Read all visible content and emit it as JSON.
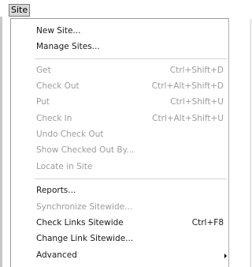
{
  "menubar": {
    "title": "Site"
  },
  "menu": {
    "new_site": "New Site...",
    "manage_sites": "Manage Sites...",
    "get": {
      "label": "Get",
      "shortcut": "Ctrl+Shift+D"
    },
    "check_out": {
      "label": "Check Out",
      "shortcut": "Ctrl+Alt+Shift+D"
    },
    "put": {
      "label": "Put",
      "shortcut": "Ctrl+Shift+U"
    },
    "check_in": {
      "label": "Check In",
      "shortcut": "Ctrl+Alt+Shift+U"
    },
    "undo_check_out": "Undo Check Out",
    "show_checked_out_by": "Show Checked Out By...",
    "locate_in_site": "Locate in Site",
    "reports": "Reports...",
    "synchronize_sitewide": "Synchronize Sitewide...",
    "check_links_sitewide": {
      "label": "Check Links Sitewide",
      "shortcut": "Ctrl+F8"
    },
    "change_link_sitewide": "Change Link Sitewide...",
    "advanced": "Advanced"
  },
  "colors": {
    "enabled_text": "#1a1a1a",
    "disabled_text": "#9c9c9c",
    "separator": "#d4d4d4"
  }
}
